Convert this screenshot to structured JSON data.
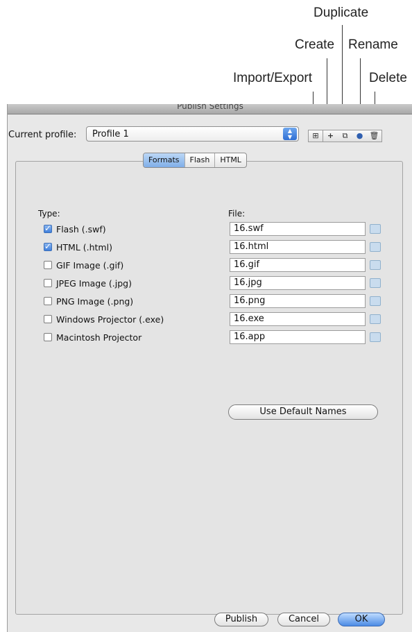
{
  "callouts": {
    "duplicate": "Duplicate",
    "create": "Create",
    "rename": "Rename",
    "import_export": "Import/Export",
    "delete": "Delete"
  },
  "window": {
    "title": "Publish Settings"
  },
  "profile": {
    "label": "Current profile:",
    "value": "Profile 1",
    "tools": [
      {
        "name": "import-export",
        "icon": "import-export-icon"
      },
      {
        "name": "create",
        "icon": "plus-icon"
      },
      {
        "name": "duplicate",
        "icon": "duplicate-icon"
      },
      {
        "name": "rename",
        "icon": "info-icon"
      },
      {
        "name": "delete",
        "icon": "trash-icon"
      }
    ]
  },
  "tabs": [
    "Formats",
    "Flash",
    "HTML"
  ],
  "active_tab": "Formats",
  "formats": {
    "type_header": "Type:",
    "file_header": "File:",
    "rows": [
      {
        "label": "Flash  (.swf)",
        "checked": true,
        "file": "16.swf"
      },
      {
        "label": "HTML (.html)",
        "checked": true,
        "file": "16.html"
      },
      {
        "label": "GIF Image (.gif)",
        "checked": false,
        "file": "16.gif"
      },
      {
        "label": "JPEG Image (.jpg)",
        "checked": false,
        "file": "16.jpg"
      },
      {
        "label": "PNG Image (.png)",
        "checked": false,
        "file": "16.png"
      },
      {
        "label": "Windows Projector (.exe)",
        "checked": false,
        "file": "16.exe"
      },
      {
        "label": "Macintosh Projector",
        "checked": false,
        "file": "16.app"
      }
    ],
    "default_names_button": "Use Default Names"
  },
  "buttons": {
    "publish": "Publish",
    "cancel": "Cancel",
    "ok": "OK"
  }
}
